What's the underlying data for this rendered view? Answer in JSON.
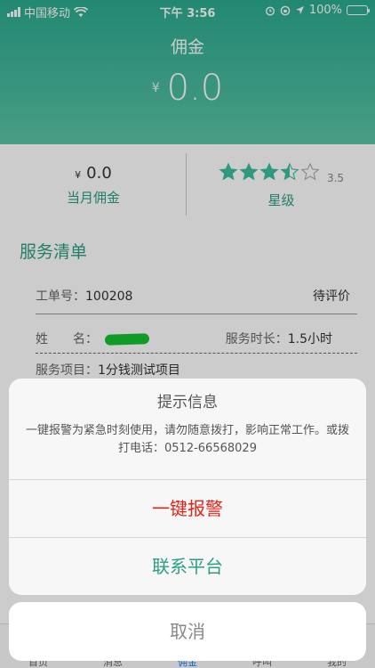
{
  "status_bar": {
    "carrier": "中国移动",
    "time": "下午 3:56",
    "battery": "100%"
  },
  "header": {
    "title": "佣金",
    "currency": "¥",
    "amount": "0.0"
  },
  "stats": {
    "monthly": {
      "currency": "¥",
      "value": "0.0",
      "label": "当月佣金"
    },
    "rating": {
      "stars": 3.5,
      "max": 5,
      "value_text": "3.5",
      "label": "星级",
      "color": "#3dbf9f"
    }
  },
  "service": {
    "section_title": "服务清单",
    "order_label": "工单号：",
    "order_number": "100208",
    "order_status": "待评价",
    "name_label": "姓　　名：",
    "duration_label": "服务时长：",
    "duration_value": "1.5小时",
    "project_label": "服务项目：",
    "project_value": "1分钱测试项目"
  },
  "tabbar": {
    "items": [
      "首页",
      "消息",
      "佣金",
      "呼叫",
      "我的"
    ],
    "active": "佣金"
  },
  "action_sheet": {
    "title": "提示信息",
    "message": "一键报警为紧急时刻使用，请勿随意拨打，影响正常工作。或拨打电话：0512-66568029",
    "alarm_label": "一键报警",
    "contact_label": "联系平台",
    "cancel_label": "取消"
  }
}
